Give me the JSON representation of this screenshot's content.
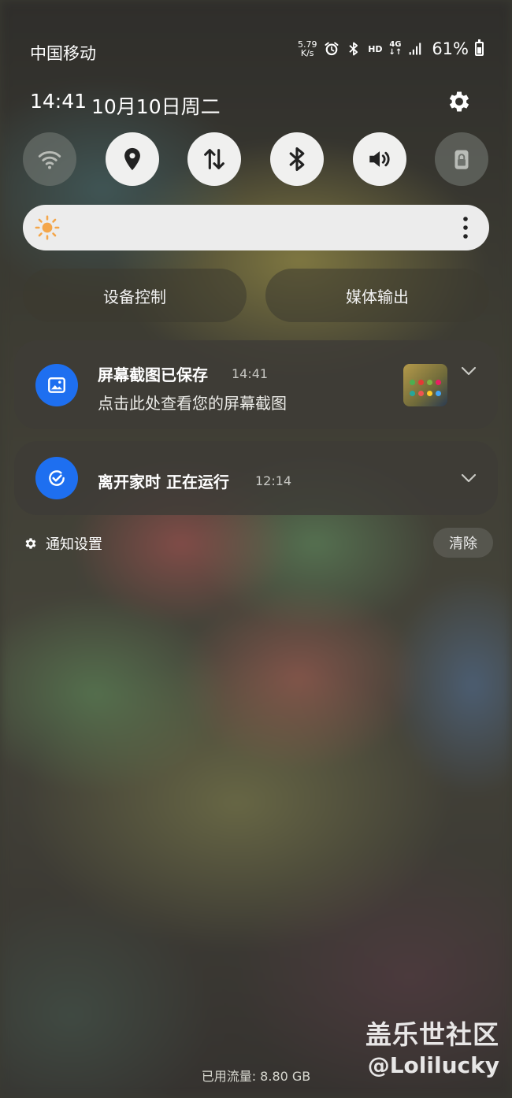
{
  "status_bar": {
    "carrier": "中国移动",
    "net_speed_value": "5.79",
    "net_speed_unit": "K/s",
    "hd_label": "HD",
    "network_type": "4G",
    "battery_percent": "61%",
    "icons": [
      "alarm-icon",
      "bluetooth-icon",
      "hd-icon",
      "4g-icon",
      "signal-icon",
      "battery-icon"
    ]
  },
  "header": {
    "time": "14:41",
    "date": "10月10日周二"
  },
  "quick_toggles": [
    {
      "name": "wifi",
      "icon": "wifi-icon",
      "active": false
    },
    {
      "name": "location",
      "icon": "location-pin-icon",
      "active": true
    },
    {
      "name": "mobile-data",
      "icon": "data-arrows-icon",
      "active": true
    },
    {
      "name": "bluetooth",
      "icon": "bluetooth-icon",
      "active": true
    },
    {
      "name": "sound",
      "icon": "volume-icon",
      "active": true
    },
    {
      "name": "rotation-lock",
      "icon": "lock-icon",
      "active": false
    }
  ],
  "brightness": {
    "level": 0.0,
    "sun_color": "#f4a64a"
  },
  "buttons": {
    "device_control": "设备控制",
    "media_output": "媒体输出"
  },
  "notifications": [
    {
      "title": "屏幕截图已保存",
      "time": "14:41",
      "body": "点击此处查看您的屏幕截图",
      "icon": "image-icon"
    },
    {
      "title": "离开家时 正在运行",
      "time": "12:14",
      "icon": "routine-check-icon"
    }
  ],
  "footer": {
    "notification_settings": "通知设置",
    "clear": "清除",
    "data_usage": "已用流量: 8.80 GB"
  },
  "watermark": {
    "line1": "盖乐世社区",
    "line2": "@Lolilucky"
  },
  "colors": {
    "accent_blue": "#1e6ff0",
    "toggle_on": "#f0f0ef",
    "toggle_off": "#6e726d"
  }
}
